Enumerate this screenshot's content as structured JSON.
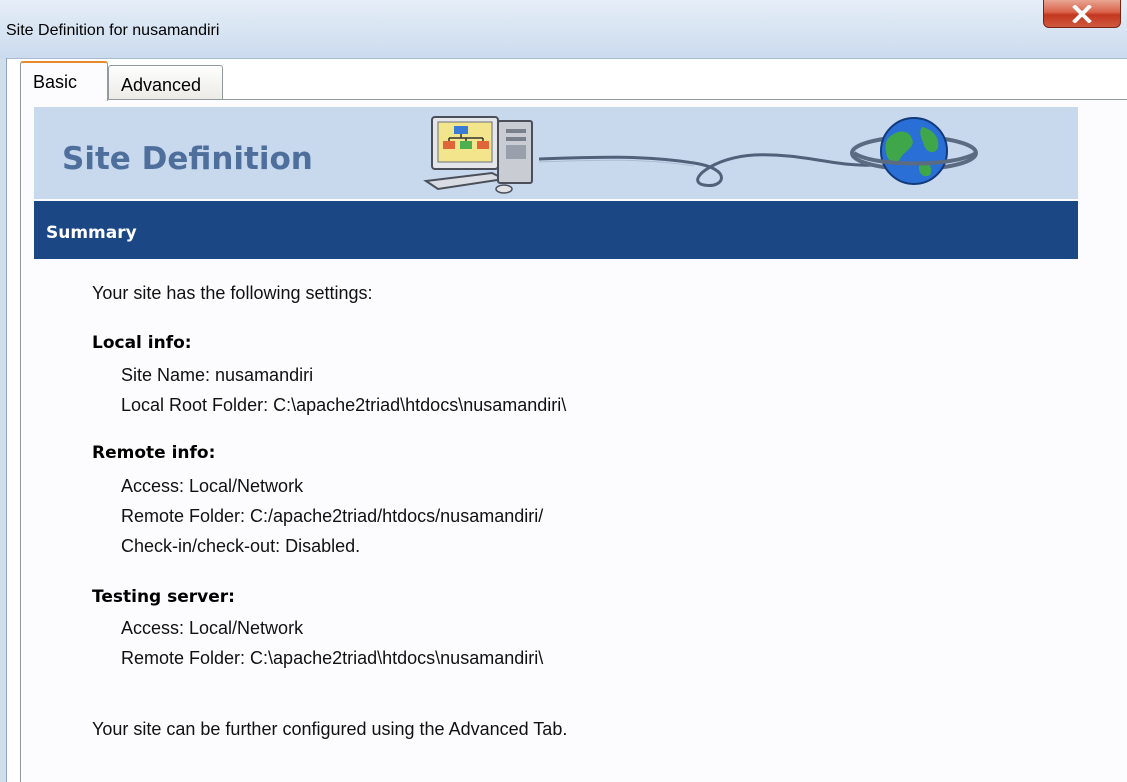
{
  "window": {
    "title": "Site Definition for nusamandiri",
    "close_icon": "close-x-icon"
  },
  "tabs": [
    {
      "label": "Basic",
      "selected": true
    },
    {
      "label": "Advanced",
      "selected": false
    }
  ],
  "banner": {
    "title": "Site Definition",
    "icons": [
      "computer-icon",
      "globe-icon"
    ]
  },
  "summary": {
    "header": "Summary",
    "intro": "Your site has the following settings:",
    "local_info": {
      "heading": "Local info:",
      "site_name": "Site Name: nusamandiri",
      "local_root": "Local Root Folder: C:\\apache2triad\\htdocs\\nusamandiri\\"
    },
    "remote_info": {
      "heading": "Remote info:",
      "access": "Access: Local/Network",
      "remote_folder": "Remote Folder: C:/apache2triad/htdocs/nusamandiri/",
      "checkin": "Check-in/check-out: Disabled."
    },
    "testing_server": {
      "heading": "Testing server:",
      "access": "Access: Local/Network",
      "remote_folder": "Remote Folder: C:\\apache2triad\\htdocs\\nusamandiri\\"
    },
    "footer": "Your site can be further configured using the Advanced Tab."
  },
  "colors": {
    "banner_bg": "#c8d9ee",
    "banner_title": "#4e6e9c",
    "summary_bar": "#1b4884",
    "close_button": "#c2371f"
  }
}
